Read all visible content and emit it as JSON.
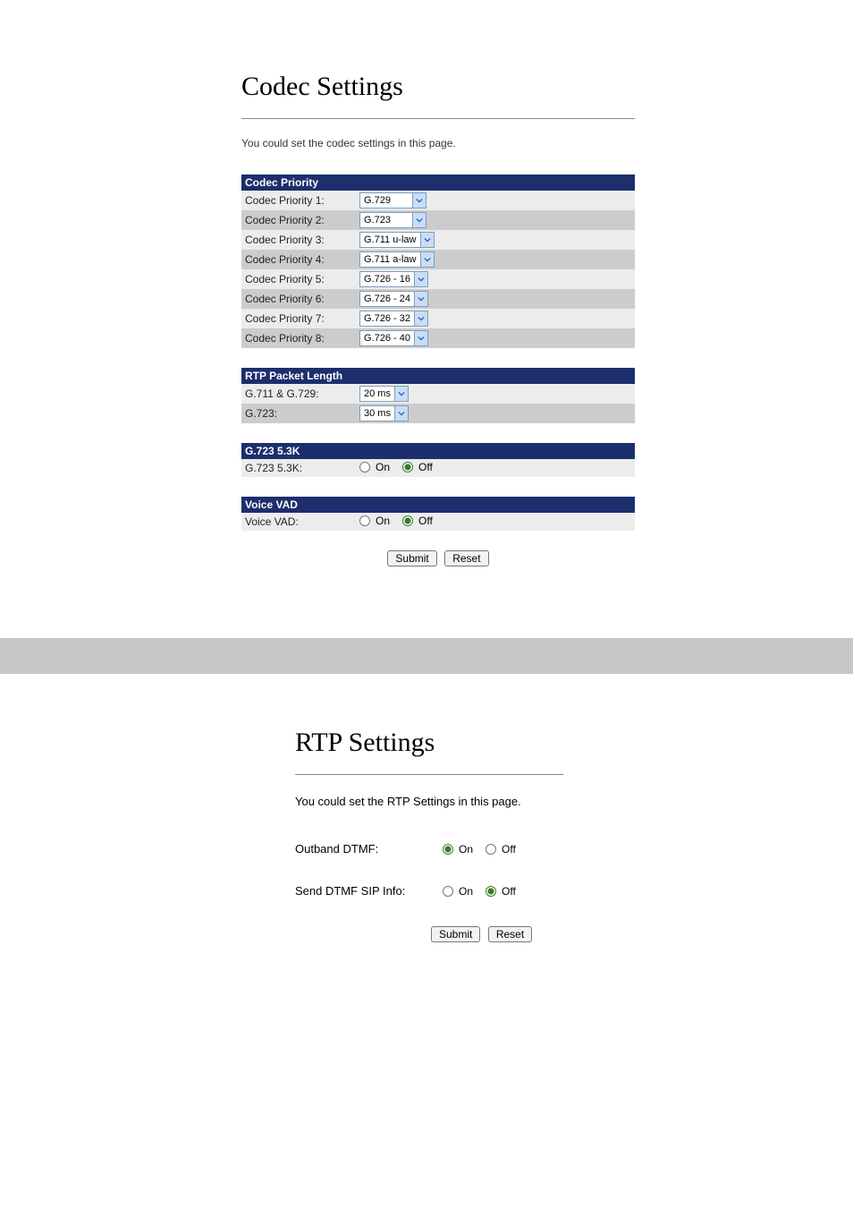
{
  "codec": {
    "title": "Codec Settings",
    "description": "You could set the codec settings in this page.",
    "priority_header": "Codec Priority",
    "priorities": [
      {
        "label": "Codec Priority 1:",
        "value": "G.729"
      },
      {
        "label": "Codec Priority 2:",
        "value": "G.723"
      },
      {
        "label": "Codec Priority 3:",
        "value": "G.711 u-law"
      },
      {
        "label": "Codec Priority 4:",
        "value": "G.711 a-law"
      },
      {
        "label": "Codec Priority 5:",
        "value": "G.726 - 16"
      },
      {
        "label": "Codec Priority 6:",
        "value": "G.726 - 24"
      },
      {
        "label": "Codec Priority 7:",
        "value": "G.726 - 32"
      },
      {
        "label": "Codec Priority 8:",
        "value": "G.726 - 40"
      }
    ],
    "rtp_header": "RTP Packet Length",
    "rtp_rows": [
      {
        "label": "G.711 & G.729:",
        "value": "20 ms"
      },
      {
        "label": "G.723:",
        "value": "30 ms"
      }
    ],
    "g723_header": "G.723 5.3K",
    "g723_label": "G.723 5.3K:",
    "vad_header": "Voice VAD",
    "vad_label": "Voice VAD:",
    "on_label": "On",
    "off_label": "Off",
    "submit_label": "Submit",
    "reset_label": "Reset"
  },
  "rtp": {
    "title": "RTP Settings",
    "description": "You could set the RTP Settings in this page.",
    "outband_label": "Outband DTMF:",
    "sip_info_label": "Send DTMF SIP Info:",
    "on_label": "On",
    "off_label": "Off",
    "submit_label": "Submit",
    "reset_label": "Reset"
  }
}
